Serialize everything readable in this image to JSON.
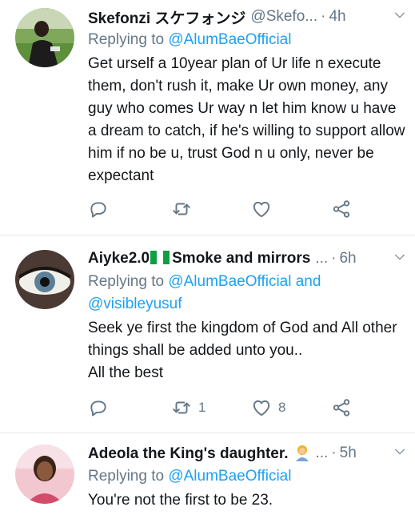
{
  "tweets": [
    {
      "name": "Skefonzi スケフォンジ",
      "handle": "@Skefo...",
      "time": "4h",
      "reply_prefix": "Replying to ",
      "reply_to": "@AlumBaeOfficial",
      "reply_to_2": "",
      "text": "Get urself a 10year plan of Ur life n execute them, don't rush it, make Ur own money, any guy who comes Ur way n let him know u have a dream to catch, if he's willing to support allow him if no be u, trust God n u only, never be expectant",
      "retweets": "",
      "likes": ""
    },
    {
      "name": "Aiyke2.0",
      "name_suffix": "Smoke and mirrors",
      "handle": "...",
      "time": "6h",
      "reply_prefix": "Replying to ",
      "reply_to": "@AlumBaeOfficial",
      "reply_and": " and",
      "reply_to_2": "@visibleyusuf",
      "text": "Seek ye first the kingdom of God and All other things shall be added unto you..\n All the best",
      "retweets": "1",
      "likes": "8"
    },
    {
      "name": "Adeola the King's daughter.",
      "handle": "...",
      "time": "5h",
      "reply_prefix": "Replying to ",
      "reply_to": "@AlumBaeOfficial",
      "text": "You're not the first to be 23."
    }
  ],
  "colors": {
    "accent": "#1da1f2",
    "muted": "#657786",
    "text": "#14171a",
    "divider": "#e1e8ed"
  },
  "icons": [
    "reply-icon",
    "retweet-icon",
    "like-icon",
    "share-icon",
    "chevron-down-icon"
  ]
}
